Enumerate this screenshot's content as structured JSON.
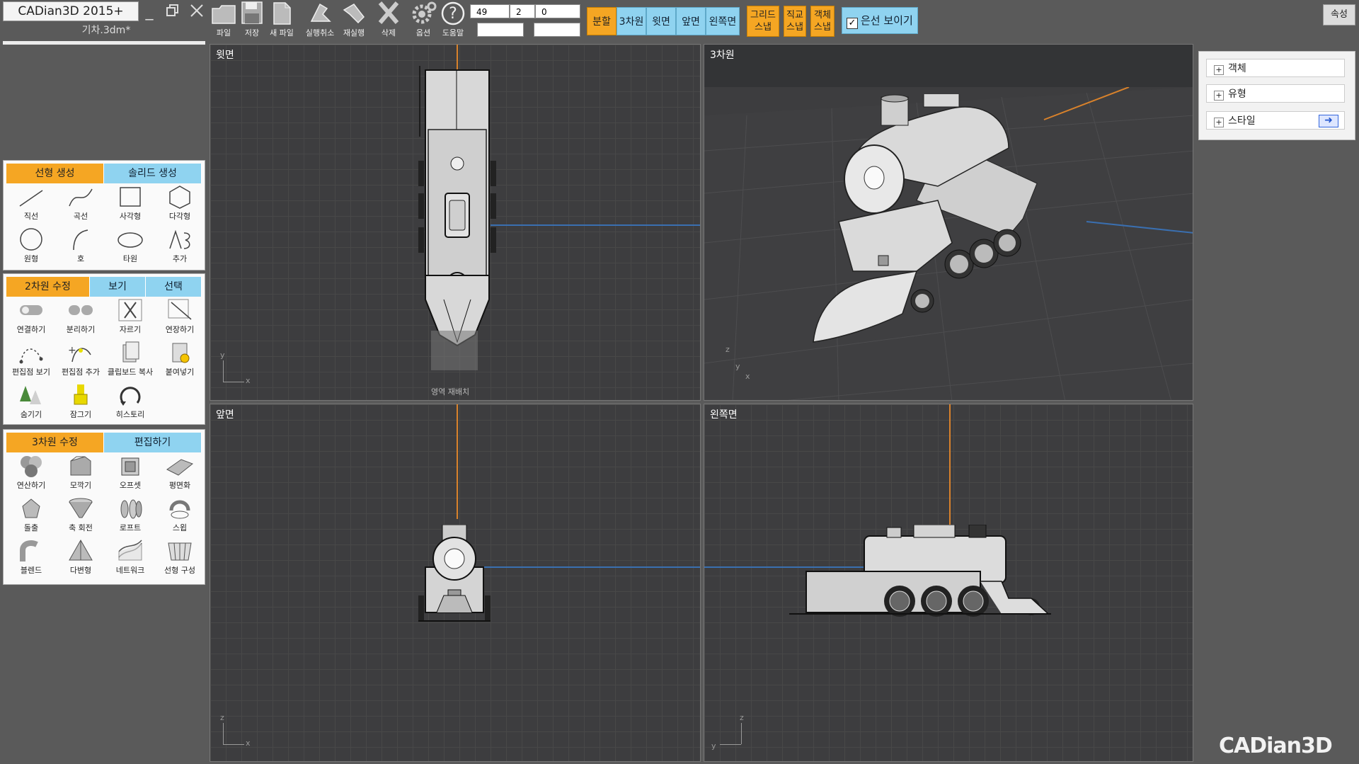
{
  "app": {
    "title": "CADian3D 2015+",
    "file_name": "기차.3dm*",
    "window_controls": [
      "minimize-icon",
      "restore-icon",
      "close-icon"
    ]
  },
  "toolbar": {
    "buttons": [
      {
        "label": "파일",
        "icon": "folder-icon"
      },
      {
        "label": "저장",
        "icon": "floppy-disk-icon"
      },
      {
        "label": "새 파일",
        "icon": "new-file-icon"
      },
      {
        "label": "실행취소",
        "icon": "undo-icon"
      },
      {
        "label": "재실행",
        "icon": "redo-icon"
      },
      {
        "label": "삭제",
        "icon": "delete-x-icon"
      },
      {
        "label": "옵션",
        "icon": "gear-icon"
      },
      {
        "label": "도움말",
        "icon": "help-icon"
      }
    ],
    "coords": {
      "x": "49",
      "y": "2",
      "z": "0"
    },
    "view_buttons": [
      "분할",
      "3차원",
      "윗면",
      "앞면",
      "왼쪽면"
    ],
    "active_view": "분할",
    "snaps": [
      "그리드 스냅",
      "직교 스냅",
      "객체 스냅"
    ],
    "snap_lines": [
      [
        "그리드",
        "스냅"
      ],
      [
        "직교",
        "스냅"
      ],
      [
        "객체",
        "스냅"
      ]
    ],
    "hidden_lines": {
      "label": "은선 보이기",
      "checked": true
    },
    "properties_button": "속성"
  },
  "panels": {
    "create": {
      "tabs": [
        "선형 생성",
        "솔리드 생성"
      ],
      "active_tab": "선형 생성",
      "tools": [
        {
          "label": "직선",
          "icon": "line-icon"
        },
        {
          "label": "곡선",
          "icon": "curve-icon"
        },
        {
          "label": "사각형",
          "icon": "rectangle-icon"
        },
        {
          "label": "다각형",
          "icon": "polygon-icon"
        },
        {
          "label": "원형",
          "icon": "circle-icon"
        },
        {
          "label": "호",
          "icon": "arc-icon"
        },
        {
          "label": "타원",
          "icon": "ellipse-icon"
        },
        {
          "label": "추가",
          "icon": "more-icon"
        }
      ]
    },
    "edit2d": {
      "tabs": [
        "2차원 수정",
        "보기",
        "선택"
      ],
      "active_tab": "2차원 수정",
      "tools": [
        {
          "label": "연결하기",
          "icon": "join-icon"
        },
        {
          "label": "분리하기",
          "icon": "explode-icon"
        },
        {
          "label": "자르기",
          "icon": "trim-icon"
        },
        {
          "label": "연장하기",
          "icon": "extend-icon"
        },
        {
          "label": "편집점 보기",
          "icon": "show-points-icon"
        },
        {
          "label": "편집점 추가",
          "icon": "add-point-icon"
        },
        {
          "label": "클립보드 복사",
          "icon": "copy-icon"
        },
        {
          "label": "붙여넣기",
          "icon": "paste-icon"
        },
        {
          "label": "숨기기",
          "icon": "hide-icon"
        },
        {
          "label": "잠그기",
          "icon": "lock-icon"
        },
        {
          "label": "히스토리",
          "icon": "history-icon"
        }
      ]
    },
    "edit3d": {
      "tabs": [
        "3차원 수정",
        "편집하기"
      ],
      "active_tab": "3차원 수정",
      "tools": [
        {
          "label": "연산하기",
          "icon": "boolean-icon"
        },
        {
          "label": "모깍기",
          "icon": "fillet-icon"
        },
        {
          "label": "오프셋",
          "icon": "offset-icon"
        },
        {
          "label": "평면화",
          "icon": "flatten-icon"
        },
        {
          "label": "돌출",
          "icon": "extrude-icon"
        },
        {
          "label": "축 회전",
          "icon": "revolve-icon"
        },
        {
          "label": "로프트",
          "icon": "loft-icon"
        },
        {
          "label": "스윕",
          "icon": "sweep-icon"
        },
        {
          "label": "블렌드",
          "icon": "blend-icon"
        },
        {
          "label": "다변형",
          "icon": "patch-icon"
        },
        {
          "label": "네트워크",
          "icon": "network-icon"
        },
        {
          "label": "선형 구성",
          "icon": "curve-network-icon"
        }
      ]
    }
  },
  "viewports": {
    "top": {
      "title": "윗면",
      "tooltip": "영역 재배치",
      "triad": [
        "y",
        "x"
      ]
    },
    "perspective": {
      "title": "3차원",
      "triad": [
        "z",
        "y",
        "x"
      ]
    },
    "front": {
      "title": "앞면",
      "triad": [
        "z",
        "x"
      ]
    },
    "left": {
      "title": "왼쪽면",
      "triad": [
        "z",
        "y"
      ]
    }
  },
  "right_panel": {
    "items": [
      {
        "label": "객체",
        "expand": "+"
      },
      {
        "label": "유형",
        "expand": "+"
      },
      {
        "label": "스타일",
        "expand": "+"
      }
    ],
    "arrow_icon": "arrow-right-icon"
  },
  "brand": "CADian3D",
  "colors": {
    "accent_orange": "#f5a623",
    "accent_blue": "#8fd3f0",
    "axis_x": "#3a6fb0",
    "axis_y": "#d9822b"
  }
}
